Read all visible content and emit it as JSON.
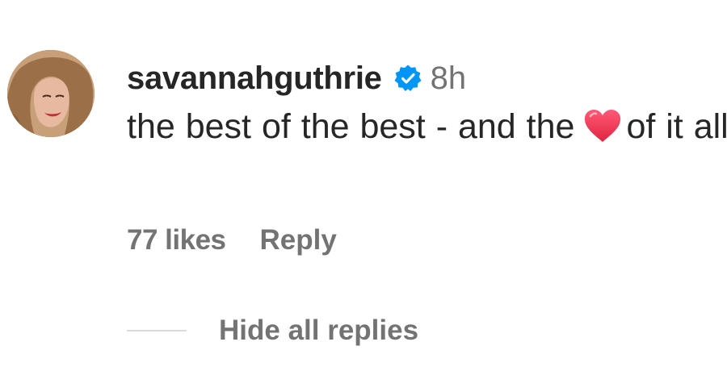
{
  "comment": {
    "username": "savannahguthrie",
    "verified_icon": "verified-badge-icon",
    "timestamp": "8h",
    "text_before_emoji": "the best of the best - and the",
    "emoji": "heart-emoji",
    "text_after_emoji": "of it all",
    "likes": "77 likes",
    "reply_label": "Reply",
    "hide_replies_label": "Hide all replies"
  },
  "colors": {
    "text_primary": "#262626",
    "text_secondary": "#737373",
    "verified_blue": "#0095f6",
    "heart_red": "#e8304f",
    "divider": "#dbdbdb"
  }
}
